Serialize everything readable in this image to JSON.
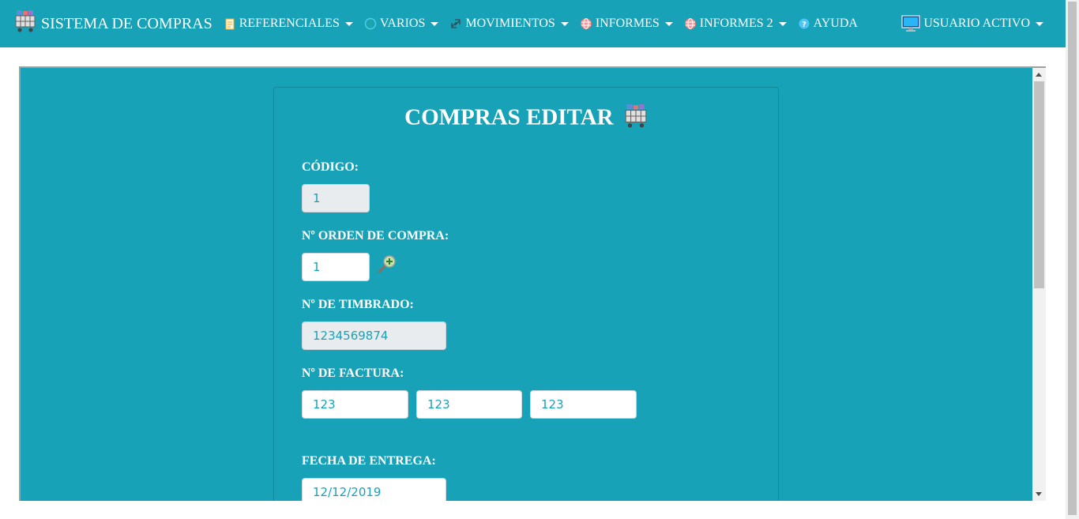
{
  "nav": {
    "brand": "SISTEMA DE COMPRAS",
    "items": [
      {
        "label": "REFERENCIALES",
        "icon": "document-icon"
      },
      {
        "label": "VARIOS",
        "icon": "plus-circle-icon"
      },
      {
        "label": "MOVIMIENTOS",
        "icon": "arrows-icon"
      },
      {
        "label": "INFORMES",
        "icon": "globe-icon"
      },
      {
        "label": "INFORMES 2",
        "icon": "globe-icon"
      },
      {
        "label": "AYUDA",
        "icon": "help-icon"
      }
    ],
    "user": {
      "label": "USUARIO ACTIVO",
      "icon": "monitor-icon"
    }
  },
  "form": {
    "title": "COMPRAS EDITAR",
    "codigo_label": "CÓDIGO:",
    "codigo_value": "1",
    "orden_label": "Nº ORDEN DE COMPRA:",
    "orden_value": "1",
    "timbrado_label": "Nº DE TIMBRADO:",
    "timbrado_value": "1234569874",
    "factura_label": "Nº DE FACTURA:",
    "factura_values": [
      "123",
      "123",
      "123"
    ],
    "fecha_label": "FECHA DE ENTREGA:",
    "fecha_value": "12/12/2019"
  },
  "colors": {
    "primary": "#17a2b8",
    "readonly_bg": "#e9ecef"
  }
}
